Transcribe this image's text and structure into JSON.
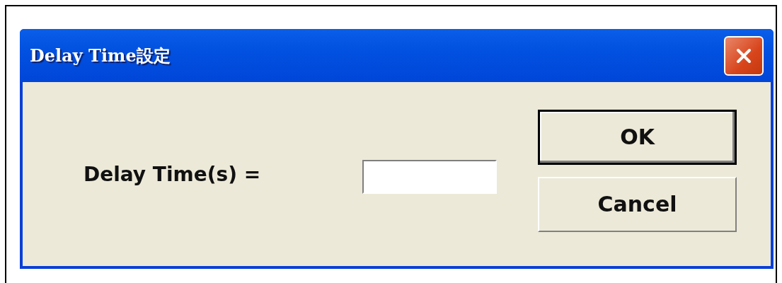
{
  "window": {
    "title": "Delay Time設定"
  },
  "field": {
    "label": "Delay Time(s) ="
  },
  "buttons": [
    {
      "label": "OK",
      "default": true
    },
    {
      "label": "Cancel",
      "default": false
    }
  ]
}
